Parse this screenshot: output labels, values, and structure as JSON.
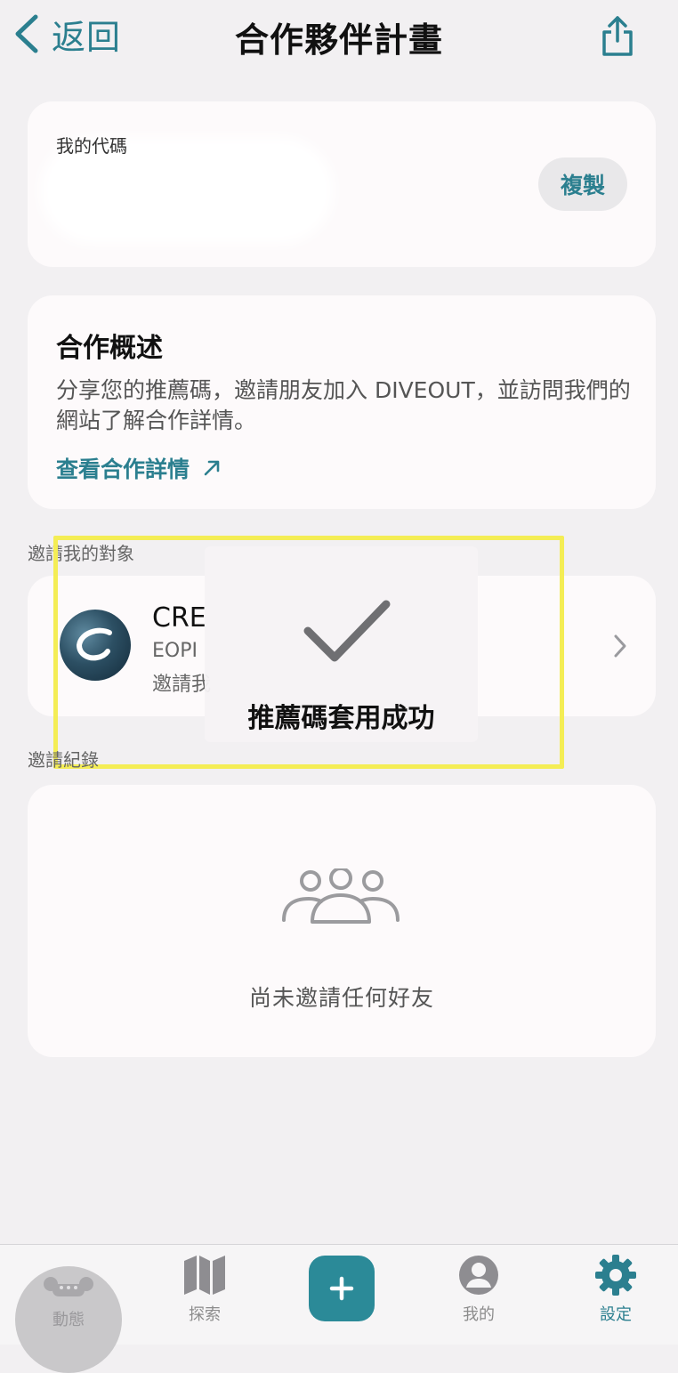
{
  "header": {
    "back_label": "返回",
    "title": "合作夥伴計畫"
  },
  "referral_code": {
    "label": "我的代碼",
    "copy_label": "複製"
  },
  "overview": {
    "title": "合作概述",
    "description": "分享您的推薦碼，邀請朋友加入 DIVEOUT，並訪問我們的網站了解合作詳情。",
    "link_label": "查看合作詳情"
  },
  "inviter": {
    "section_label": "邀請我的對象",
    "name": "CRE",
    "subtitle": "EOPI",
    "status": "邀請我"
  },
  "toast": {
    "message": "推薦碼套用成功"
  },
  "records": {
    "section_label": "邀請紀錄",
    "empty_text": "尚未邀請任何好友"
  },
  "tabbar": {
    "items": [
      {
        "label": "動態"
      },
      {
        "label": "探索"
      },
      {
        "label": ""
      },
      {
        "label": "我的"
      },
      {
        "label": "設定"
      }
    ],
    "active_index": 4
  },
  "colors": {
    "accent": "#2b7f8f",
    "background": "#f2f0f2",
    "card": "#fdfafb",
    "highlight": "#f4ed55"
  },
  "icons": {
    "back": "chevron-left-icon",
    "share": "share-icon",
    "external_link": "arrow-up-right-icon",
    "chevron": "chevron-right-icon",
    "check": "checkmark-icon",
    "friends": "group-icon",
    "feed": "feed-icon",
    "explore": "map-icon",
    "add": "plus-icon",
    "profile": "person-icon",
    "settings": "gear-icon"
  }
}
